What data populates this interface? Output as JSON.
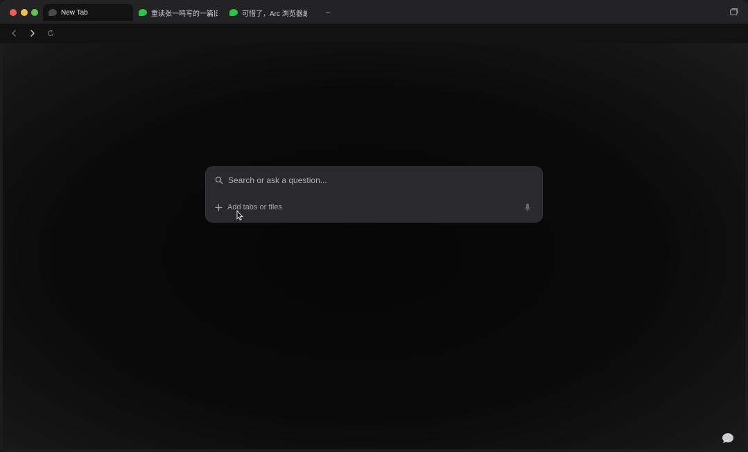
{
  "tabs": [
    {
      "label": "New Tab",
      "favicon": "newtab-icon",
      "active": true
    },
    {
      "label": "重读张一鸣写的一篇旧文",
      "favicon": "wechat-icon",
      "active": false
    },
    {
      "label": "可惜了，Arc 浏览器最终",
      "favicon": "wechat-icon",
      "active": false
    }
  ],
  "tabbar": {
    "new_tab_symbol": "−"
  },
  "search": {
    "placeholder": "Search or ask a question...",
    "value": "",
    "add_label": "Add tabs or files"
  },
  "colors": {
    "background": "#1c1c1d",
    "content": "#0a0a0a",
    "searchbox": "#2a2a2c",
    "wechat_green": "#2fc34b",
    "traffic_close": "#ed5f57",
    "traffic_min": "#f4bd4f",
    "traffic_max": "#60c453"
  },
  "icons": {
    "back": "chevron-left-icon",
    "forward": "chevron-right-icon",
    "reload": "reload-icon",
    "search": "search-icon",
    "add": "plus-icon",
    "mic": "microphone-icon",
    "tabs_overview": "tabs-overview-icon",
    "assistant": "chat-bubble-icon"
  }
}
